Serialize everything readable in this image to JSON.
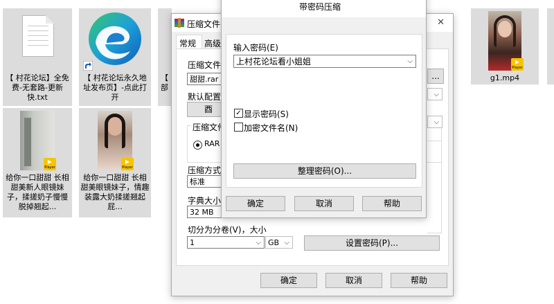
{
  "desktop": {
    "icons": [
      {
        "caption": "【 村花论坛】全免费-无套路-更新快.txt",
        "type": "text-file"
      },
      {
        "caption": "【 村花论坛永久地址发布页】-点此打开",
        "type": "edge-shortcut"
      },
      {
        "caption": "g1.mp4",
        "type": "video"
      },
      {
        "caption": "给你一口甜甜 长相甜美新人眼镜妹子，揉搓奶子慢慢脱掉翘起...",
        "type": "video"
      },
      {
        "caption": "给你一口甜甜 长相甜美眼镜妹子，情趣装露大奶揉搓翘起屁...",
        "type": "video"
      }
    ],
    "partial_label": "【\n部",
    "player_badge": "Player"
  },
  "archive_dialog": {
    "title": "压缩文件名",
    "tabs": [
      "常规",
      "高级"
    ],
    "archive_name_label": "压缩文件名",
    "archive_name_value": "甜甜.rar",
    "default_profile_label": "默认配置",
    "format_label": "压缩文件格式",
    "format_option": "RAR",
    "method_label": "压缩方式",
    "method_value": "标准",
    "dict_label": "字典大小",
    "dict_value": "32 MB",
    "split_label": "切分为分卷(V)，大小",
    "split_value": "1",
    "split_unit": "GB",
    "set_password_button": "设置密码(P)...",
    "ok": "确定",
    "cancel": "取消",
    "help": "帮助",
    "close_glyph": "✕",
    "browse_glyph": "...",
    "button_stub": "酉"
  },
  "password_dialog": {
    "title": "带密码压缩",
    "enter_password_label": "输入密码(E)",
    "password_value": "上村花论坛看小姐姐",
    "show_password_label": "显示密码(S)",
    "show_password_checked": true,
    "encrypt_names_label": "加密文件名(N)",
    "encrypt_names_checked": false,
    "organize_button": "整理密码(O)...",
    "ok": "确定",
    "cancel": "取消",
    "help": "帮助"
  }
}
